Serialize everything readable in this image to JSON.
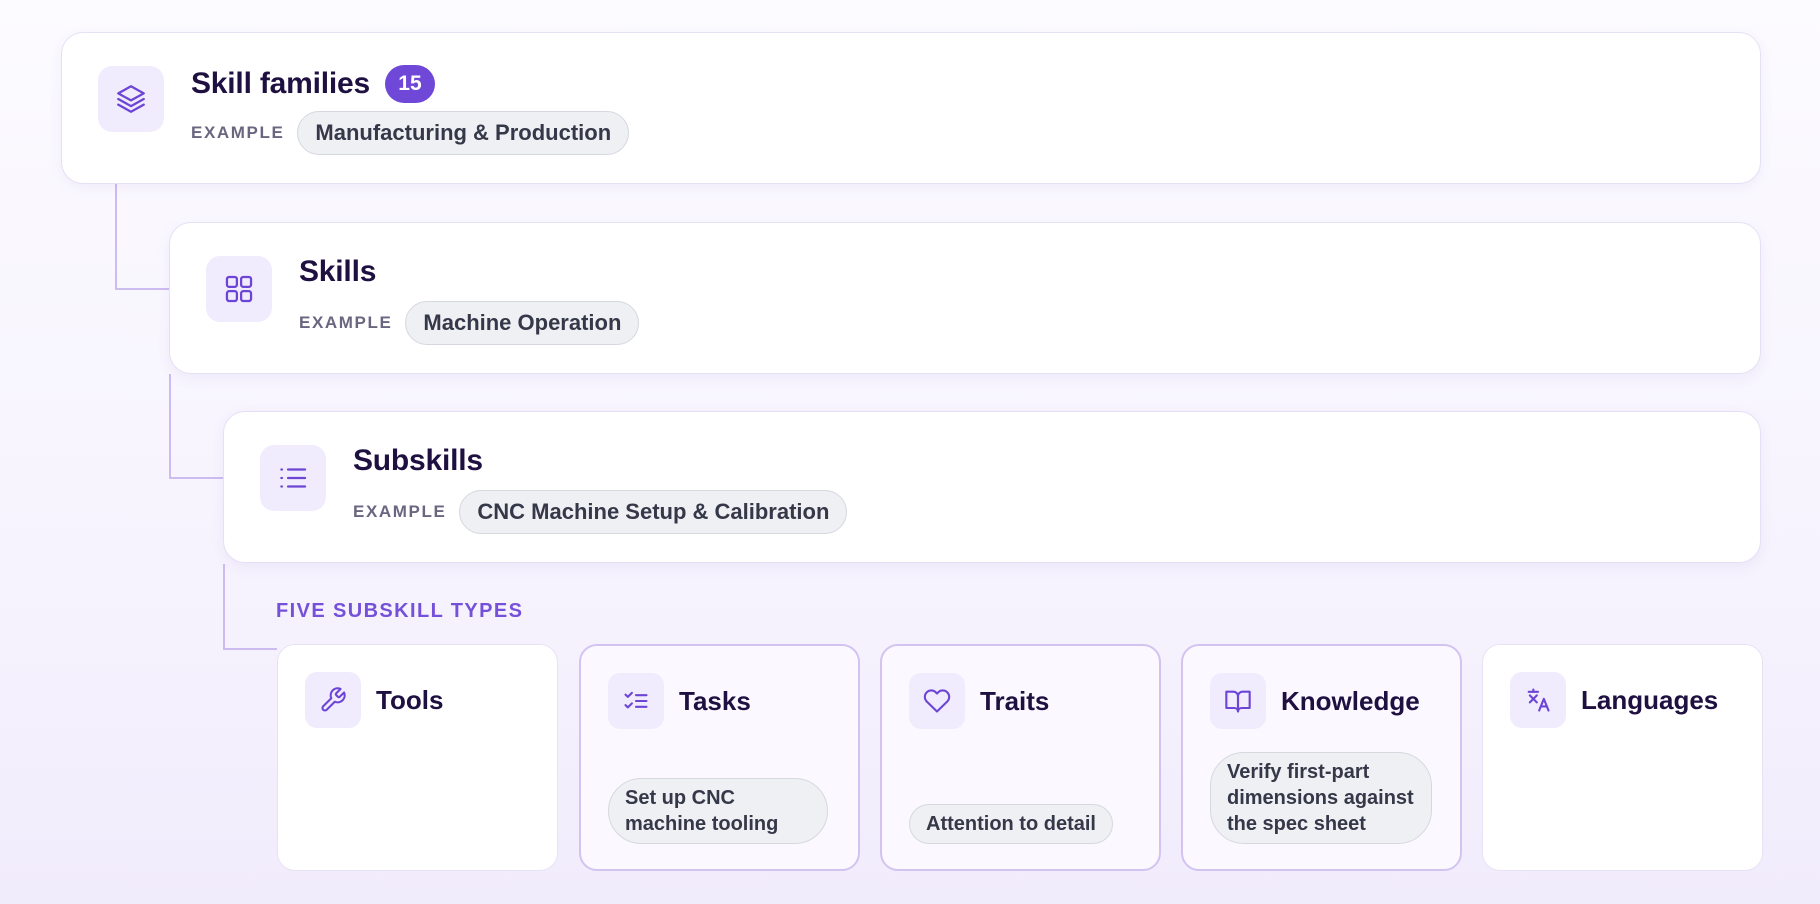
{
  "hierarchy": [
    {
      "title": "Skill families",
      "count": "15",
      "example_label": "EXAMPLE",
      "example": "Manufacturing & Production",
      "icon": "layers-icon"
    },
    {
      "title": "Skills",
      "example_label": "EXAMPLE",
      "example": "Machine Operation",
      "icon": "grid-icon"
    },
    {
      "title": "Subskills",
      "example_label": "EXAMPLE",
      "example": "CNC Machine Setup & Calibration",
      "icon": "list-icon"
    }
  ],
  "subskill_types": {
    "heading": "FIVE SUBSKILL TYPES",
    "items": [
      {
        "title": "Tools",
        "icon": "wrench-icon",
        "active": false
      },
      {
        "title": "Tasks",
        "icon": "checklist-icon",
        "active": true,
        "example": "Set up CNC machine tooling"
      },
      {
        "title": "Traits",
        "icon": "heart-icon",
        "active": true,
        "example": "Attention to detail"
      },
      {
        "title": "Knowledge",
        "icon": "book-icon",
        "active": true,
        "example": "Verify first-part dimensions against the spec sheet"
      },
      {
        "title": "Languages",
        "icon": "translate-icon",
        "active": false
      }
    ]
  },
  "colors": {
    "accent": "#7048d8",
    "connector": "#cdbcef",
    "icon_bg": "#f1ecfd",
    "title_text": "#1e1040"
  }
}
